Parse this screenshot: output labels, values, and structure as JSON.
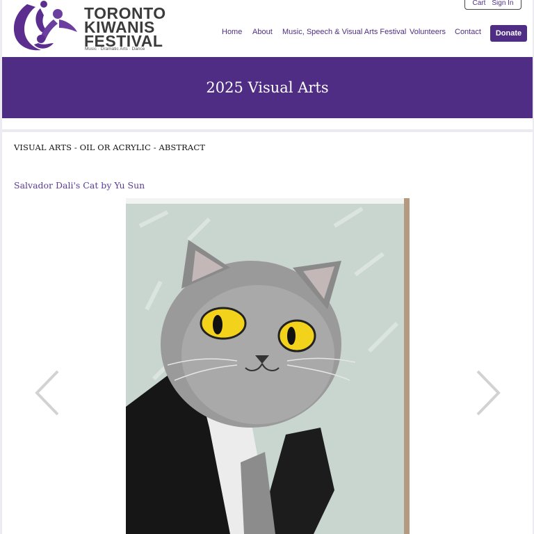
{
  "header": {
    "logo": {
      "line1": "TORONTO",
      "line2": "KIWANIS",
      "line3": "FESTIVAL",
      "tagline": "Music · Dramatic Arts · Dance"
    },
    "account": {
      "cart_label": "Cart",
      "signin_label": "Sign In"
    },
    "nav": [
      {
        "label": "Home"
      },
      {
        "label": "About"
      },
      {
        "label": "Music, Speech & Visual Arts Festival"
      },
      {
        "label": "Volunteers"
      },
      {
        "label": "Contact"
      }
    ],
    "donate_label": "Donate",
    "brand_color": "#502d85"
  },
  "banner": {
    "title": "2025 Visual Arts"
  },
  "main": {
    "category": "VISUAL ARTS - OIL OR ACRYLIC - ABSTRACT",
    "artwork": {
      "title": "Salvador Dali's Cat by Yu Sun"
    },
    "carousel": {
      "prev_icon": "chevron-left-icon",
      "next_icon": "chevron-right-icon"
    }
  }
}
